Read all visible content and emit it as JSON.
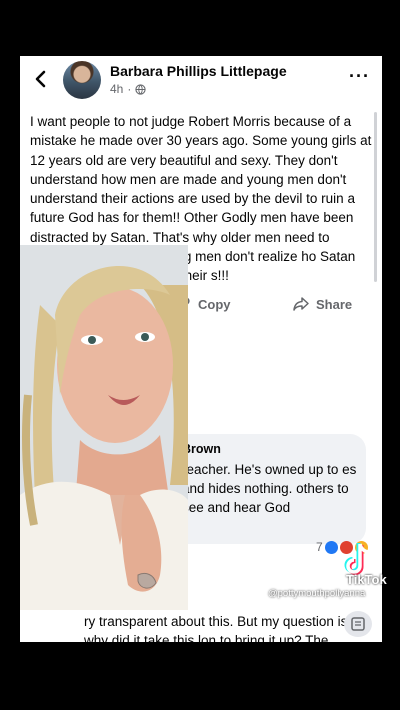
{
  "header": {
    "author": "Barbara Phillips Littlepage",
    "time": "4h"
  },
  "post": {
    "text": "I want people to not judge Robert Morris because of a mistake he made over 30 years ago.  Some young girls at 12 years old are very beautiful and sexy. They don't understand how men are made and young men don't understand their actions are used by the devil to ruin a future God has for them!! Other Godly men have been distracted by Satan. That's why older men need to mentor young men!! Young men don't realize ho  Satan      destroy their futures with their                 s!!!"
  },
  "actions": {
    "copy": "Copy",
    "share": "Share"
  },
  "comment": {
    "author": "Brown",
    "text": "reacher. He's owned up to es and hides nothing. others to see and hear God",
    "reaction_count": "7"
  },
  "lower_comment": {
    "text": "ry transparent about this. But my question is why did it take this lon to bring it up? The church is under attack"
  },
  "watermark": {
    "brand": "TikTok",
    "handle": "@pottymouthpollyanna"
  },
  "colors": {
    "background": "#000000",
    "card": "#ffffff",
    "secondary_text": "#65676b"
  }
}
